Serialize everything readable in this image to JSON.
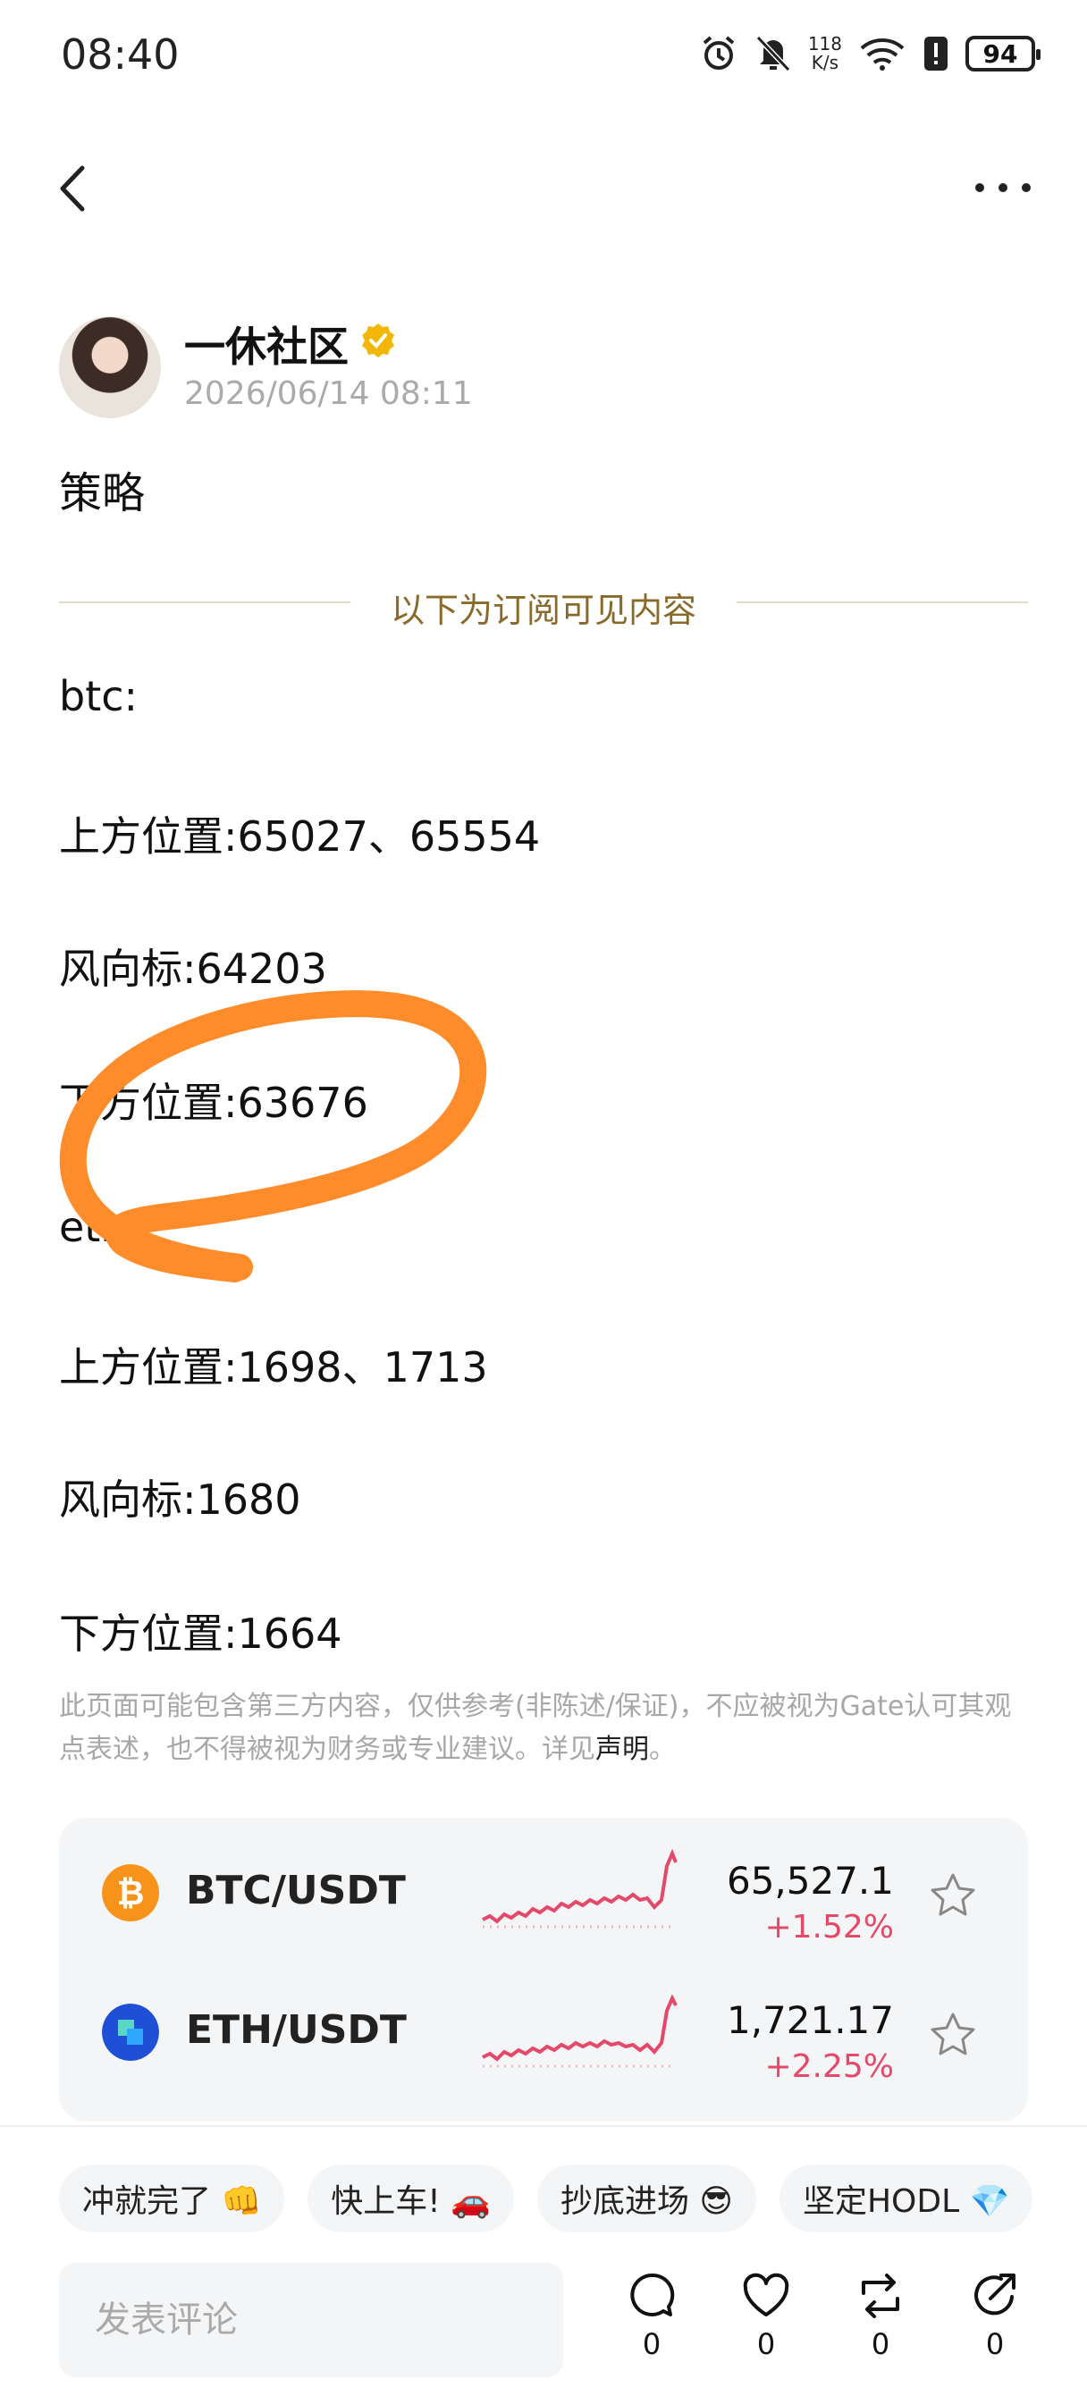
{
  "status_bar": {
    "time": "08:40",
    "net_speed_top": "118",
    "net_speed_bottom": "K/s",
    "battery": "94",
    "icons": [
      "alarm-icon",
      "mute-icon",
      "wifi-icon",
      "alert-icon",
      "battery-icon"
    ]
  },
  "nav": {
    "back_icon": "chevron-left-icon",
    "more_icon": "more-dots-icon"
  },
  "post": {
    "author": "一休社区",
    "verified_color": "#f2b705",
    "time": "2026/06/14 08:11",
    "title": "策略",
    "divider_label": "以下为订阅可见内容",
    "lines": [
      "btc:",
      "上方位置:65027、65554",
      "风向标:64203",
      "下方位置:63676",
      "eth:",
      "上方位置:1698、1713",
      "风向标:1680",
      "下方位置:1664"
    ],
    "disclaimer_text": "此页面可能包含第三方内容，仅供参考(非陈述/保证)，不应被视为Gate认可其观点表述，也不得被视为财务或专业建议。详见",
    "disclaimer_link": "声明",
    "disclaimer_end": "。"
  },
  "markets": [
    {
      "pair": "BTC/USDT",
      "price": "65,527.1",
      "change": "+1.52%",
      "icon_color": "#f7931a",
      "icon": "bitcoin-icon"
    },
    {
      "pair": "ETH/USDT",
      "price": "1,721.17",
      "change": "+2.25%",
      "icon_color": "#1f4fd6",
      "icon": "eth-icon"
    }
  ],
  "colors": {
    "positive": "#e5496a",
    "annotation": "#ff8c2a",
    "gold": "#8a6a2a"
  },
  "bottom": {
    "chips": [
      "冲就完了 👊",
      "快上车! 🚗",
      "抄底进场 😎",
      "坚定HODL 💎"
    ],
    "comment_placeholder": "发表评论",
    "comment_count": "0",
    "like_count": "0",
    "repost_count": "0",
    "share_count": "0"
  }
}
